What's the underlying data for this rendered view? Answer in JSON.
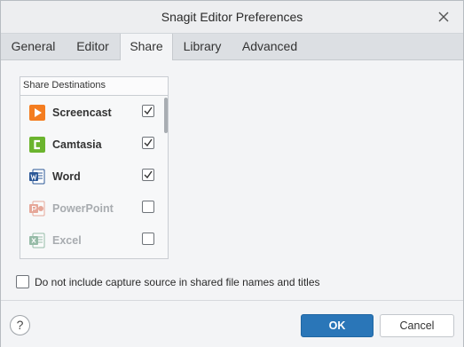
{
  "window": {
    "title": "Snagit Editor Preferences"
  },
  "tabs": [
    {
      "label": "General",
      "active": false
    },
    {
      "label": "Editor",
      "active": false
    },
    {
      "label": "Share",
      "active": true
    },
    {
      "label": "Library",
      "active": false
    },
    {
      "label": "Advanced",
      "active": false
    }
  ],
  "share_destinations": {
    "header": "Share Destinations",
    "items": [
      {
        "label": "Screencast",
        "icon": "screencast-icon",
        "checked": true,
        "enabled": true
      },
      {
        "label": "Camtasia",
        "icon": "camtasia-icon",
        "checked": true,
        "enabled": true
      },
      {
        "label": "Word",
        "icon": "word-icon",
        "checked": true,
        "enabled": true
      },
      {
        "label": "PowerPoint",
        "icon": "powerpoint-icon",
        "checked": false,
        "enabled": false
      },
      {
        "label": "Excel",
        "icon": "excel-icon",
        "checked": false,
        "enabled": false
      }
    ]
  },
  "options": {
    "exclude_source_label": "Do not include capture source in shared file names and titles",
    "exclude_source_checked": false
  },
  "footer": {
    "help_label": "?",
    "ok_label": "OK",
    "cancel_label": "Cancel"
  },
  "colors": {
    "accent": "#2a76b8",
    "screencast": "#f47d20",
    "camtasia": "#6bb42e",
    "word": "#2b5797",
    "powerpoint": "#d24726",
    "excel": "#217346"
  }
}
